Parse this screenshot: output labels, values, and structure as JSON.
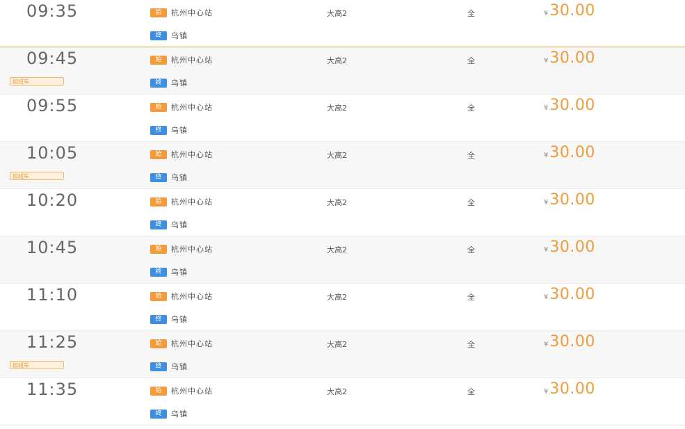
{
  "schedule": {
    "rows": [
      {
        "time": "09:35",
        "flag": "",
        "start_tag": "始",
        "start": "杭州中心站",
        "end_tag": "终",
        "end": "乌镇",
        "bus_type": "大高2",
        "seats": "全",
        "currency": "¥",
        "price": "30.00"
      },
      {
        "time": "09:45",
        "flag": "加班车",
        "start_tag": "始",
        "start": "杭州中心站",
        "end_tag": "终",
        "end": "乌镇",
        "bus_type": "大高2",
        "seats": "全",
        "currency": "¥",
        "price": "30.00"
      },
      {
        "time": "09:55",
        "flag": "",
        "start_tag": "始",
        "start": "杭州中心站",
        "end_tag": "终",
        "end": "乌镇",
        "bus_type": "大高2",
        "seats": "全",
        "currency": "¥",
        "price": "30.00"
      },
      {
        "time": "10:05",
        "flag": "加班车",
        "start_tag": "始",
        "start": "杭州中心站",
        "end_tag": "终",
        "end": "乌镇",
        "bus_type": "大高2",
        "seats": "全",
        "currency": "¥",
        "price": "30.00"
      },
      {
        "time": "10:20",
        "flag": "",
        "start_tag": "始",
        "start": "杭州中心站",
        "end_tag": "终",
        "end": "乌镇",
        "bus_type": "大高2",
        "seats": "全",
        "currency": "¥",
        "price": "30.00"
      },
      {
        "time": "10:45",
        "flag": "",
        "start_tag": "始",
        "start": "杭州中心站",
        "end_tag": "终",
        "end": "乌镇",
        "bus_type": "大高2",
        "seats": "全",
        "currency": "¥",
        "price": "30.00"
      },
      {
        "time": "11:10",
        "flag": "",
        "start_tag": "始",
        "start": "杭州中心站",
        "end_tag": "终",
        "end": "乌镇",
        "bus_type": "大高2",
        "seats": "全",
        "currency": "¥",
        "price": "30.00"
      },
      {
        "time": "11:25",
        "flag": "加班车",
        "start_tag": "始",
        "start": "杭州中心站",
        "end_tag": "终",
        "end": "乌镇",
        "bus_type": "大高2",
        "seats": "全",
        "currency": "¥",
        "price": "30.00"
      },
      {
        "time": "11:35",
        "flag": "",
        "start_tag": "始",
        "start": "杭州中心站",
        "end_tag": "终",
        "end": "乌镇",
        "bus_type": "大高2",
        "seats": "全",
        "currency": "¥",
        "price": "30.00"
      }
    ]
  },
  "colors": {
    "accent_orange": "#f09a3c",
    "start_tag": "#f39a3a",
    "end_tag": "#3f8fe0",
    "row_alt": "#f7f7f7"
  }
}
